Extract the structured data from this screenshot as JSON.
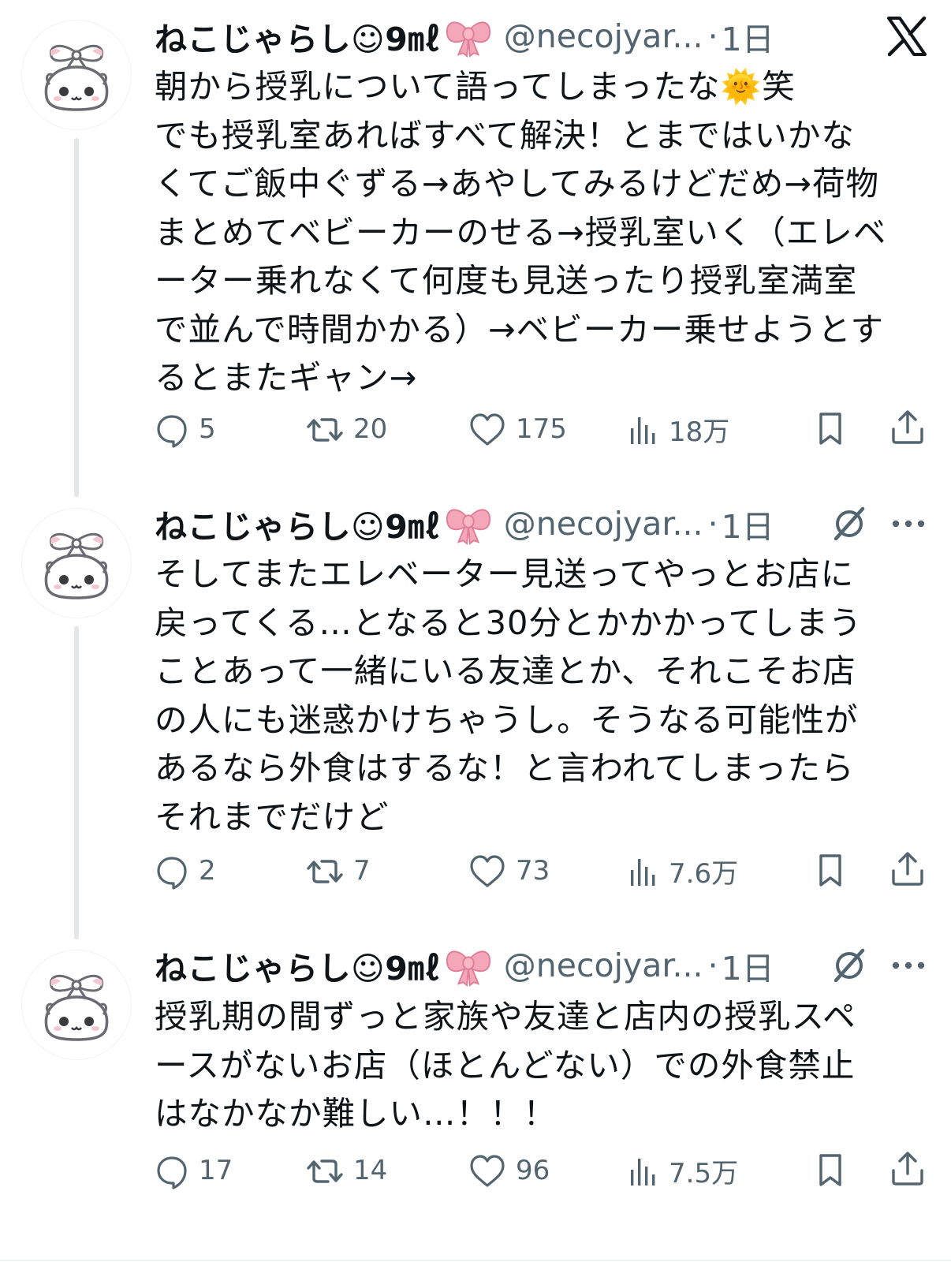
{
  "app": {
    "logo": "x-logo-icon"
  },
  "posts": [
    {
      "name": "ねこじゃらし☺9㎖",
      "handle": "@necojyar...",
      "separator": "·",
      "date": "1日",
      "text": "朝から授乳について語ってしまったな🌞笑\nでも授乳室あればすべて解決！とまではいかな\nくてご飯中ぐずる→あやしてみるけどだめ→荷物\nまとめてベビーカーのせる→授乳室いく（エレベ\nーター乗れなくて何度も見送ったり授乳室満室\nで並んで時間かかる）→ベビーカー乗せようとす\nるとまたギャン→",
      "replies": "5",
      "reposts": "20",
      "likes": "175",
      "views": "18万"
    },
    {
      "name": "ねこじゃらし☺9㎖",
      "handle": "@necojyar...",
      "separator": "·",
      "date": "1日",
      "text": "そしてまたエレベーター見送ってやっとお店に\n戻ってくる…となると30分とかかかってしまう\nことあって一緒にいる友達とか、それこそお店\nの人にも迷惑かけちゃうし。そうなる可能性が\nあるなら外食はするな！と言われてしまったら\nそれまでだけど",
      "replies": "2",
      "reposts": "7",
      "likes": "73",
      "views": "7.6万"
    },
    {
      "name": "ねこじゃらし☺9㎖",
      "handle": "@necojyar...",
      "separator": "·",
      "date": "1日",
      "text": "授乳期の間ずっと家族や友達と店内の授乳スペ\nースがないお店（ほとんどない）での外食禁止\nはなかなか難しい…！！！",
      "replies": "17",
      "reposts": "14",
      "likes": "96",
      "views": "7.5万"
    }
  ],
  "icons": {
    "avatar": "cat-with-ribbon-avatar",
    "ribbon": "pink-ribbon-emoji",
    "reply": "reply-icon",
    "repost": "repost-icon",
    "like": "heart-icon",
    "views": "views-chart-icon",
    "bookmark": "bookmark-icon",
    "share": "share-icon",
    "grok": "grok-icon",
    "more": "more-dots-icon"
  },
  "colors": {
    "text": "#0f1419",
    "secondary": "#536471",
    "icon": "#536471",
    "thread_line": "#e3e7e9",
    "ribbon": "#f4a7b9"
  }
}
